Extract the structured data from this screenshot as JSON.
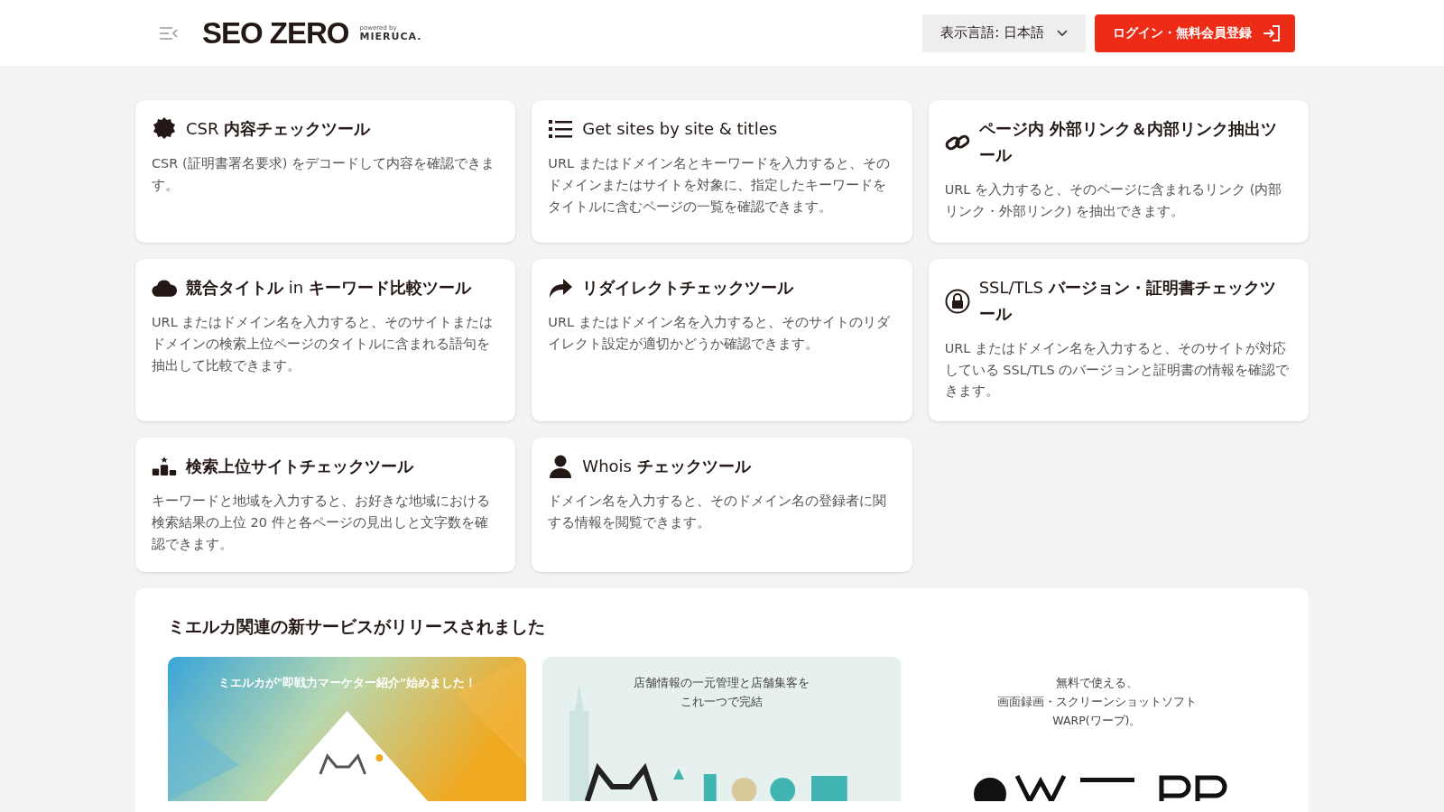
{
  "header": {
    "logo": "SEO ZERO",
    "powered_by": "powered by",
    "powered_brand": "MIERUCA.",
    "language_button": "表示言語: 日本語",
    "login_button": "ログイン・無料会員登録"
  },
  "tools": [
    {
      "kind": "badge",
      "title": "CSR **内容チェックツール**",
      "description": "CSR (証明書署名要求) をデコードして内容を確認できます。"
    },
    {
      "kind": "list",
      "title": "Get sites by site & titles",
      "description": "URL またはドメイン名とキーワードを入力すると、そのドメインまたはサイトを対象に、指定したキーワードをタイトルに含むページの一覧を確認できます。"
    },
    {
      "kind": "link",
      "title": "**ページ内 外部リンク＆内部リンク抽出ツール**",
      "description": "URL を入力すると、そのページに含まれるリンク (内部リンク・外部リンク) を抽出できます。"
    },
    {
      "kind": "cloud",
      "title": "**競合タイトル** in **キーワード比較ツール**",
      "description": "URL またはドメイン名を入力すると、そのサイトまたはドメインの検索上位ページのタイトルに含まれる語句を抽出して比較できます。"
    },
    {
      "kind": "redirect",
      "title": "**リダイレクトチェックツール**",
      "description": "URL またはドメイン名を入力すると、そのサイトのリダイレクト設定が適切かどうか確認できます。"
    },
    {
      "kind": "lock",
      "title": "SSL/TLS **バージョン・証明書チェックツール**",
      "description": "URL またはドメイン名を入力すると、そのサイトが対応している SSL/TLS のバージョンと証明書の情報を確認できます。"
    },
    {
      "kind": "ranking",
      "title": "**検索上位サイトチェックツール**",
      "description": "キーワードと地域を入力すると、お好きな地域における検索結果の上位 20 件と各ページの見出しと文字数を確認できます。"
    },
    {
      "kind": "person",
      "title": "Whois **チェックツール**",
      "description": "ドメイン名を入力すると、そのドメイン名の登録者に関する情報を閲覧できます。"
    }
  ],
  "services": {
    "title": "ミエルカ関連の新サービスがリリースされました",
    "banners": [
      {
        "kind": "gradient",
        "caption": [
          "ミエルカが\"即戦力マーケター紹介\"始めました！"
        ]
      },
      {
        "kind": "mint",
        "caption": [
          "店舗情報の一元管理と店舗集客を",
          "これ一つで完結"
        ]
      },
      {
        "kind": "plain",
        "caption": [
          "無料で使える、",
          "画面録画・スクリーンショットソフト",
          "WARP(ワープ)。"
        ]
      }
    ]
  }
}
